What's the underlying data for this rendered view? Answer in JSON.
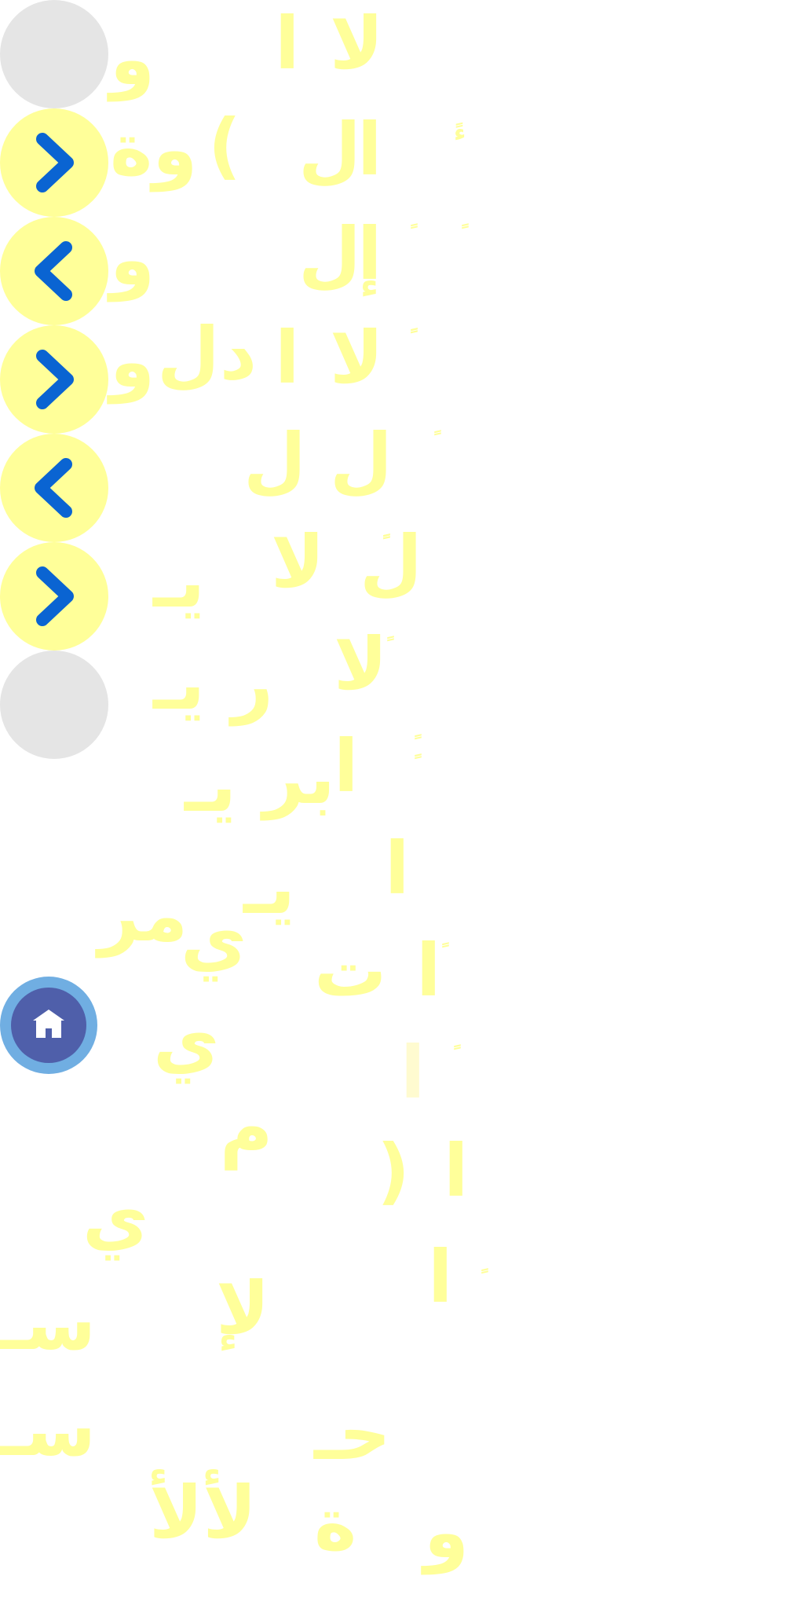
{
  "nav": {
    "buttons": [
      {
        "state": "disabled",
        "icon": ""
      },
      {
        "state": "active",
        "icon": "chevron-right-icon"
      },
      {
        "state": "active",
        "icon": "chevron-left-icon"
      },
      {
        "state": "active",
        "icon": "chevron-right-icon"
      },
      {
        "state": "active",
        "icon": "chevron-left-icon"
      },
      {
        "state": "active",
        "icon": "chevron-right-icon"
      },
      {
        "state": "disabled",
        "icon": ""
      }
    ],
    "home_icon": "home-icon"
  },
  "colors": {
    "disabled_circle": "#e5e5e5",
    "active_circle": "#ffff99",
    "chevron": "#0a64d2",
    "home_outer": "#70aee2",
    "home_inner": "#4f5faa",
    "glyph": "#ffff9a"
  },
  "glyphs": {
    "r1_a": "و",
    "r1_b": "ا",
    "r1_c": "لا",
    "r2_a": "وة",
    "r2_b": "(",
    "r2_c": "ل",
    "r2_d": "ا",
    "r2_e": "ءً",
    "r3_a": "و",
    "r3_b": "ل",
    "r3_c": "إ",
    "r3_d": "ً",
    "r3_e": "ً",
    "r4_a": "و",
    "r4_b": "دل",
    "r4_c": "ا",
    "r4_d": "لا",
    "r4_e": "ًً",
    "r5_a": "ل",
    "r5_b": "ل",
    "r5_c": "ً",
    "r6_a": "يـ",
    "r6_b": "لا",
    "r6_c": "ل",
    "r6_d": "ًًً",
    "r7_a": "يـ",
    "r7_b": "ر",
    "r7_c": "لا",
    "r7_d": "ً",
    "r8_a": "يـ",
    "r8_b": "بر",
    "r8_c": "ا",
    "r8_d": "ًٍ",
    "r9_a": "يـ",
    "r9_b": "ا",
    "r10_a": "مر",
    "r10_b": "ي",
    "r11_a": "ت",
    "r11_b": "ا",
    "r11_c": "ً",
    "r12_a": "ي",
    "r12_b": "ا",
    "r12_c": "ً",
    "r13_a": "م",
    "r14_a": ")",
    "r14_b": "ا",
    "r15_a": "ي",
    "r16_a": "لإ",
    "r16_b": "سـ",
    "r16_c": "ا",
    "r16_d": "ٍ",
    "r17_a": "سـ",
    "r17_b": "حـ",
    "r18_a": "لألأ",
    "r18_b": "ة",
    "r18_c": "و"
  }
}
